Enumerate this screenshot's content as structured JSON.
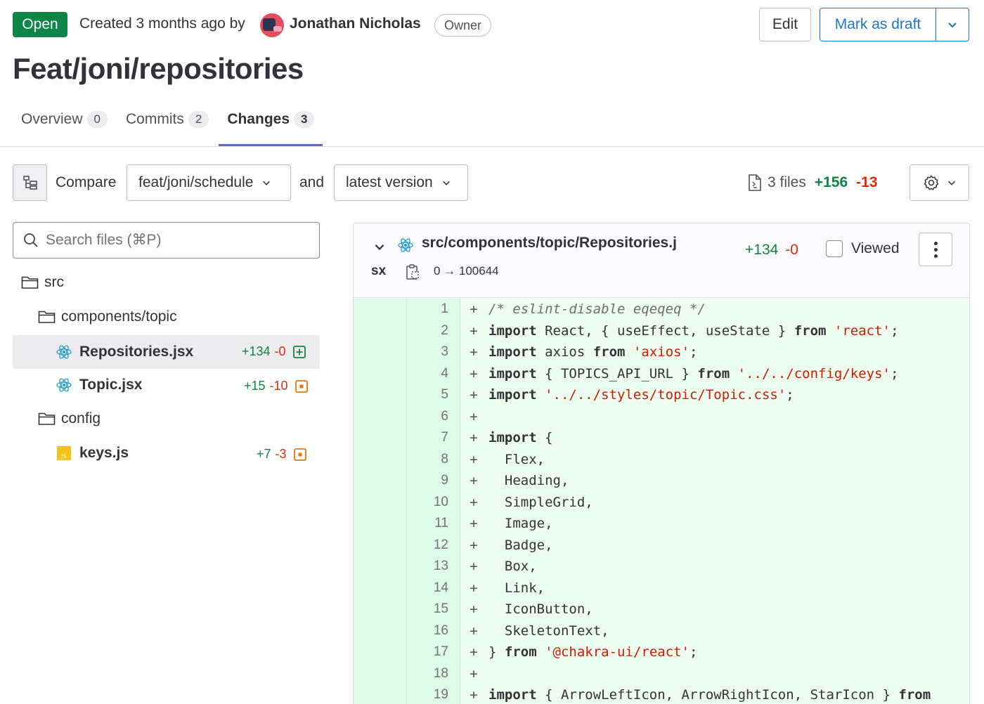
{
  "header": {
    "status": "Open",
    "created_text": "Created 3 months ago by",
    "author": "Jonathan Nicholas",
    "role": "Owner",
    "edit_label": "Edit",
    "draft_label": "Mark as draft"
  },
  "title": "Feat/joni/repositories",
  "tabs": [
    {
      "label": "Overview",
      "count": "0"
    },
    {
      "label": "Commits",
      "count": "2"
    },
    {
      "label": "Changes",
      "count": "3"
    }
  ],
  "compare": {
    "label": "Compare",
    "source": "feat/joni/schedule",
    "and": "and",
    "target": "latest version"
  },
  "summary": {
    "files": "3 files",
    "added": "+156",
    "removed": "-13"
  },
  "search": {
    "placeholder": "Search files (⌘P)"
  },
  "tree": {
    "folder_src": "src",
    "folder_components": "components/topic",
    "file_repositories": {
      "name": "Repositories.jsx",
      "added": "+134",
      "removed": "-0"
    },
    "file_topic": {
      "name": "Topic.jsx",
      "added": "+15",
      "removed": "-10"
    },
    "folder_config": "config",
    "file_keys": {
      "name": "keys.js",
      "added": "+7",
      "removed": "-3"
    }
  },
  "diff": {
    "path_line1": "src/components/topic/Repositories.j",
    "path_line2": "sx",
    "mode_change": "0 → 100644",
    "added": "+134",
    "removed": "-0",
    "viewed_label": "Viewed",
    "lines": [
      {
        "n": "1"
      },
      {
        "n": "2"
      },
      {
        "n": "3"
      },
      {
        "n": "4"
      },
      {
        "n": "5"
      },
      {
        "n": "6"
      },
      {
        "n": "7"
      },
      {
        "n": "8"
      },
      {
        "n": "9"
      },
      {
        "n": "10"
      },
      {
        "n": "11"
      },
      {
        "n": "12"
      },
      {
        "n": "13"
      },
      {
        "n": "14"
      },
      {
        "n": "15"
      },
      {
        "n": "16"
      },
      {
        "n": "17"
      },
      {
        "n": "18"
      },
      {
        "n": "19"
      }
    ],
    "code": {
      "l1": "/* eslint-disable eqeqeq */",
      "import": "import",
      "from": "from",
      "l2_a": " React, { useEffect, useState } ",
      "l2_str": "'react'",
      "l3_a": " axios ",
      "l3_str": "'axios'",
      "l4_a": " { TOPICS_API_URL } ",
      "l4_str": "'../../config/keys'",
      "l5_a": " ",
      "l5_str": "'../../styles/topic/Topic.css'",
      "semi": ";",
      "l7_a": " {",
      "l8": "  Flex,",
      "l9": "  Heading,",
      "l10": "  SimpleGrid,",
      "l11": "  Image,",
      "l12": "  Badge,",
      "l13": "  Box,",
      "l14": "  Link,",
      "l15": "  IconButton,",
      "l16": "  SkeletonText,",
      "l17_a": "} ",
      "l17_b": " ",
      "l17_str": "'@chakra-ui/react'",
      "l19_a": " { ArrowLeftIcon, ArrowRightIcon, StarIcon } "
    }
  }
}
